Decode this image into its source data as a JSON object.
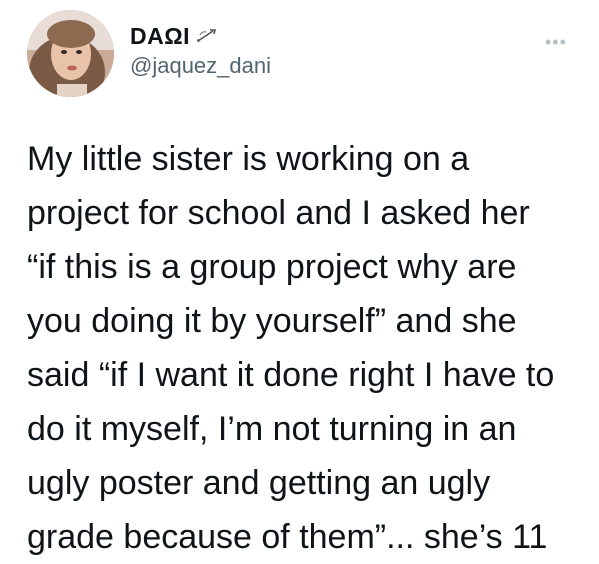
{
  "author": {
    "display_name": "DAΩI",
    "name_emoji": "bow-and-arrow-icon",
    "handle": "@jaquez_dani"
  },
  "menu": {
    "icon": "more-options-icon",
    "glyph": "•••"
  },
  "tweet": {
    "lines": [
      "My little sister is working on a",
      "project for school and I asked her",
      "“if this is a group project why are",
      "you doing it by yourself” and she",
      "said “if I want it done right I have to",
      "do it myself, I’m not turning in an",
      "ugly poster and getting an ugly",
      "grade because of them”... she’s 11"
    ]
  }
}
